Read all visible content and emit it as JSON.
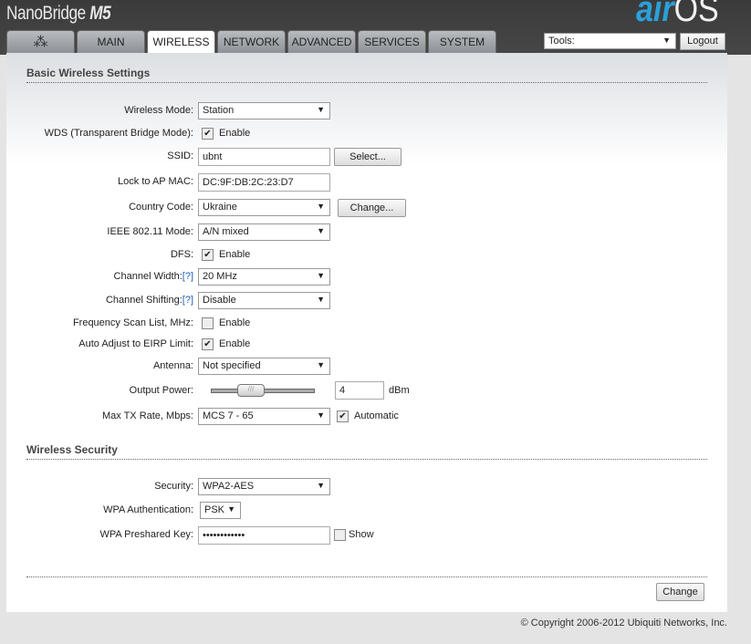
{
  "header": {
    "product": "NanoBridge",
    "model": "M5",
    "os_air": "air",
    "os_os": "OS"
  },
  "tabs": [
    {
      "label": "ubnt-logo"
    },
    {
      "label": "MAIN"
    },
    {
      "label": "WIRELESS"
    },
    {
      "label": "NETWORK"
    },
    {
      "label": "ADVANCED"
    },
    {
      "label": "SERVICES"
    },
    {
      "label": "SYSTEM"
    }
  ],
  "tools": {
    "value": "Tools:"
  },
  "logout": "Logout",
  "basic": {
    "title": "Basic Wireless Settings",
    "wireless_mode": {
      "label": "Wireless Mode:",
      "value": "Station"
    },
    "wds": {
      "label": "WDS (Transparent Bridge Mode):",
      "text": "Enable",
      "checked": true
    },
    "ssid": {
      "label": "SSID:",
      "value": "ubnt",
      "button": "Select..."
    },
    "lock_ap": {
      "label": "Lock to AP MAC:",
      "value": "DC:9F:DB:2C:23:D7"
    },
    "country": {
      "label": "Country Code:",
      "value": "Ukraine",
      "button": "Change..."
    },
    "ieee": {
      "label": "IEEE 802.11 Mode:",
      "value": "A/N mixed"
    },
    "dfs": {
      "label": "DFS:",
      "text": "Enable",
      "checked": true
    },
    "channel_width": {
      "label": "Channel Width:",
      "help": "[?]",
      "value": "20 MHz"
    },
    "channel_shifting": {
      "label": "Channel Shifting:",
      "help": "[?]",
      "value": "Disable"
    },
    "freq_scan": {
      "label": "Frequency Scan List, MHz:",
      "text": "Enable",
      "checked": false
    },
    "eirp": {
      "label": "Auto Adjust to EIRP Limit:",
      "text": "Enable",
      "checked": true
    },
    "antenna": {
      "label": "Antenna:",
      "value": "Not specified"
    },
    "output_power": {
      "label": "Output Power:",
      "value": "4",
      "unit": "dBm",
      "slider_fraction": 0.37
    },
    "max_tx": {
      "label": "Max TX Rate, Mbps:",
      "value": "MCS 7 - 65",
      "auto_text": "Automatic",
      "auto_checked": true
    }
  },
  "security": {
    "title": "Wireless Security",
    "security": {
      "label": "Security:",
      "value": "WPA2-AES"
    },
    "wpa_auth": {
      "label": "WPA Authentication:",
      "value": "PSK"
    },
    "psk": {
      "label": "WPA Preshared Key:",
      "value": "••••••••••••",
      "show": "Show"
    }
  },
  "change_button": "Change",
  "copyright": "© Copyright 2006-2012 Ubiquiti Networks, Inc."
}
